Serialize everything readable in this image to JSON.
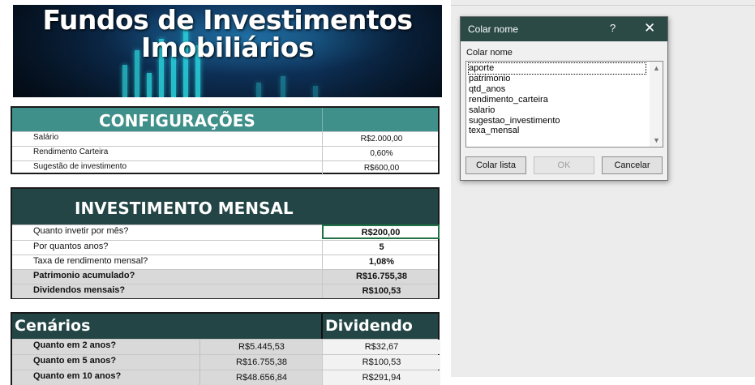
{
  "banner": {
    "line1": "Fundos de Investimentos",
    "line2": "Imobiliários"
  },
  "config": {
    "title": "CONFIGURAÇÕES",
    "rows": [
      {
        "label": "Salário",
        "value": "R$2.000,00"
      },
      {
        "label": "Rendimento Carteira",
        "value": "0,60%"
      },
      {
        "label": "Sugestão de investimento",
        "value": "R$600,00"
      }
    ]
  },
  "investimento": {
    "title": "INVESTIMENTO MENSAL",
    "rows": [
      {
        "label": "Quanto invetir por mês?",
        "value": "R$200,00"
      },
      {
        "label": "Por quantos anos?",
        "value": "5"
      },
      {
        "label": "Taxa de rendimento mensal?",
        "value": "1,08%"
      },
      {
        "label": "Patrimonio acumulado?",
        "value": "R$16.755,38"
      },
      {
        "label": "Dividendos mensais?",
        "value": "R$100,53"
      }
    ]
  },
  "cenarios": {
    "title": "Cenários",
    "dividendo_header": "Dividendo",
    "rows": [
      {
        "label": "Quanto em 2 anos?",
        "patrimonio": "R$5.445,53",
        "dividendo": "R$32,67"
      },
      {
        "label": "Quanto em 5 anos?",
        "patrimonio": "R$16.755,38",
        "dividendo": "R$100,53"
      },
      {
        "label": "Quanto em 10 anos?",
        "patrimonio": "R$48.656,84",
        "dividendo": "R$291,94"
      }
    ]
  },
  "dialog": {
    "title": "Colar nome",
    "help": "?",
    "close": "✕",
    "caption": "Colar nome",
    "names": [
      "aporte",
      "patrimonio",
      "qtd_anos",
      "rendimento_carteira",
      "salario",
      "sugestao_investimento",
      "texa_mensal"
    ],
    "buttons": {
      "paste_list": "Colar lista",
      "ok": "OK",
      "cancel": "Cancelar"
    }
  }
}
